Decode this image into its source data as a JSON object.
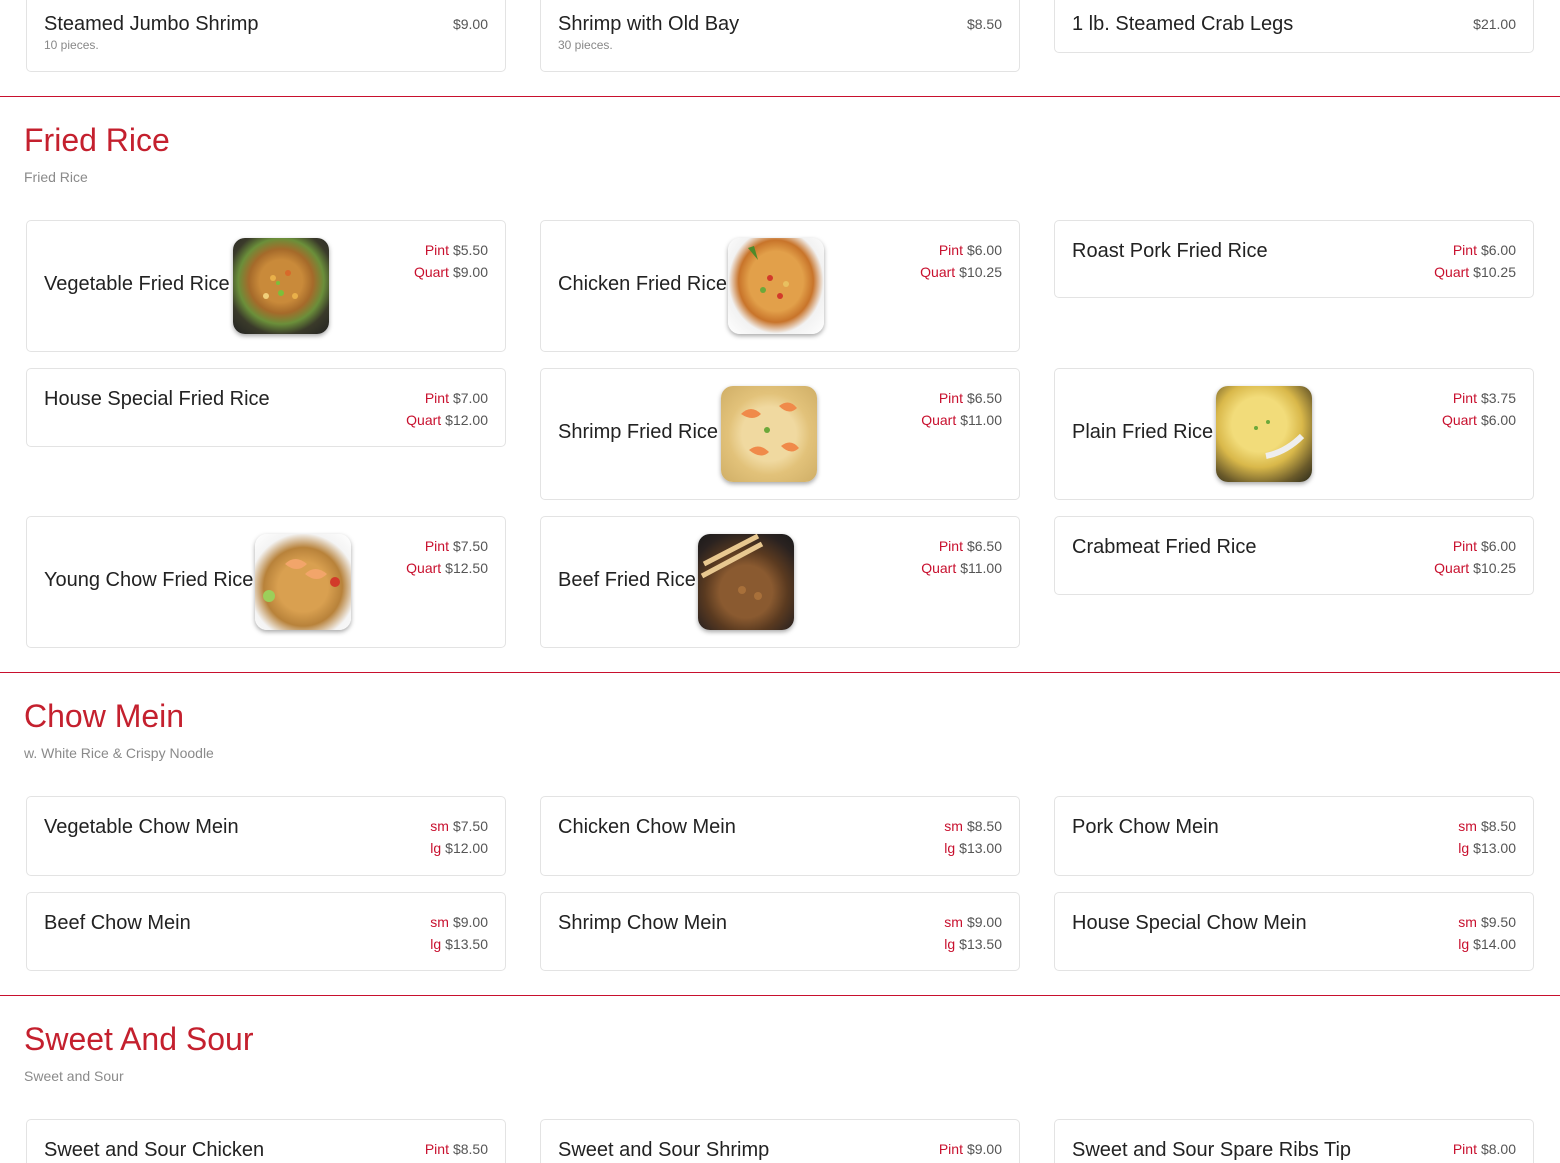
{
  "colors": {
    "accent": "#c8102e",
    "title": "#c4202e",
    "border": "#e3e3e3"
  },
  "top_items": [
    {
      "name": "Steamed Jumbo Shrimp",
      "desc": "10 pieces.",
      "price": "$9.00"
    },
    {
      "name": "Shrimp with Old Bay",
      "desc": "30 pieces.",
      "price": "$8.50"
    },
    {
      "name": "1 lb. Steamed Crab Legs",
      "price": "$21.00"
    }
  ],
  "fried_rice": {
    "title": "Fried Rice",
    "subtitle": "Fried Rice",
    "size_a": "Pint",
    "size_b": "Quart",
    "items": [
      {
        "name": "Vegetable Fried Rice",
        "pint": "$5.50",
        "quart": "$9.00",
        "image": "vegetable-fried-rice-photo"
      },
      {
        "name": "Chicken Fried Rice",
        "pint": "$6.00",
        "quart": "$10.25",
        "image": "chicken-fried-rice-photo"
      },
      {
        "name": "Roast Pork Fried Rice",
        "pint": "$6.00",
        "quart": "$10.25"
      },
      {
        "name": "House Special Fried Rice",
        "pint": "$7.00",
        "quart": "$12.00"
      },
      {
        "name": "Shrimp Fried Rice",
        "pint": "$6.50",
        "quart": "$11.00",
        "image": "shrimp-fried-rice-photo"
      },
      {
        "name": "Plain Fried Rice",
        "pint": "$3.75",
        "quart": "$6.00",
        "image": "plain-fried-rice-photo"
      },
      {
        "name": "Young Chow Fried Rice",
        "pint": "$7.50",
        "quart": "$12.50",
        "image": "young-chow-fried-rice-photo"
      },
      {
        "name": "Beef Fried Rice",
        "pint": "$6.50",
        "quart": "$11.00",
        "image": "beef-fried-rice-photo"
      },
      {
        "name": "Crabmeat Fried Rice",
        "pint": "$6.00",
        "quart": "$10.25"
      }
    ]
  },
  "chow_mein": {
    "title": "Chow Mein",
    "subtitle": "w. White Rice & Crispy Noodle",
    "size_a": "sm",
    "size_b": "lg",
    "items": [
      {
        "name": "Vegetable Chow Mein",
        "sm": "$7.50",
        "lg": "$12.00"
      },
      {
        "name": "Chicken Chow Mein",
        "sm": "$8.50",
        "lg": "$13.00"
      },
      {
        "name": "Pork Chow Mein",
        "sm": "$8.50",
        "lg": "$13.00"
      },
      {
        "name": "Beef Chow Mein",
        "sm": "$9.00",
        "lg": "$13.50"
      },
      {
        "name": "Shrimp Chow Mein",
        "sm": "$9.00",
        "lg": "$13.50"
      },
      {
        "name": "House Special Chow Mein",
        "sm": "$9.50",
        "lg": "$14.00"
      }
    ]
  },
  "sweet_and_sour": {
    "title": "Sweet And Sour",
    "subtitle": "Sweet and Sour",
    "size_a": "Pint",
    "items": [
      {
        "name": "Sweet and Sour Chicken",
        "pint": "$8.50"
      },
      {
        "name": "Sweet and Sour Shrimp",
        "pint": "$9.00"
      },
      {
        "name": "Sweet and Sour Spare Ribs Tip",
        "pint": "$8.00"
      }
    ]
  }
}
